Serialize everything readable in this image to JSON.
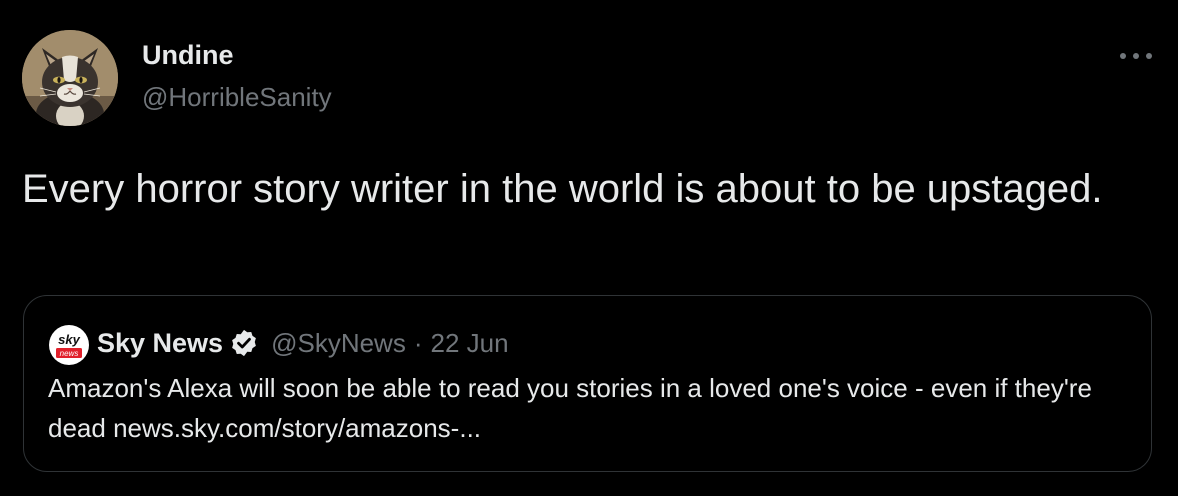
{
  "tweet": {
    "author": {
      "name": "Undine",
      "handle": "@HorribleSanity",
      "avatar": "cat-avatar"
    },
    "text": "Every horror story writer in the world is about to be upstaged.",
    "more_icon": "ellipsis-icon",
    "quoted": {
      "name": "Sky News",
      "handle": "@SkyNews",
      "separator": "·",
      "date": "22 Jun",
      "verified_icon": "verified-badge-icon",
      "logo": {
        "top": "sky",
        "bottom": "news"
      },
      "text": "Amazon's Alexa will soon be able to read you stories in a loved one's voice - even if they're dead news.sky.com/story/amazons-..."
    }
  },
  "colors": {
    "background": "#000000",
    "primary_text": "#e7e9ea",
    "secondary_text": "#71767b",
    "border": "#2f3336",
    "sky_red": "#e1202b"
  }
}
